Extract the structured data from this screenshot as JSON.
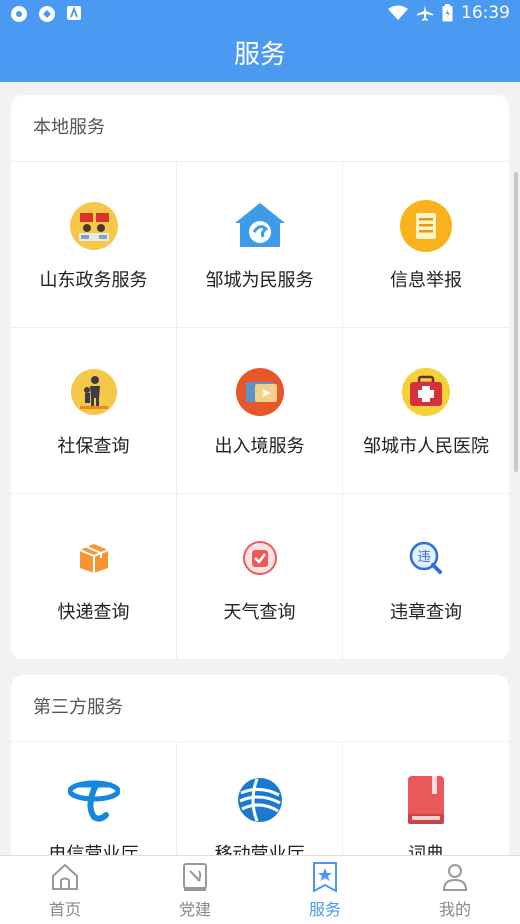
{
  "status": {
    "time": "16:39",
    "icons": [
      "app-icon-1",
      "app-icon-2",
      "app-icon-3",
      "wifi-icon",
      "airplane-icon",
      "battery-icon"
    ]
  },
  "header": {
    "title": "服务"
  },
  "local": {
    "title": "本地服务",
    "items": [
      {
        "label": "山东政务服务",
        "icon": "government-service-icon"
      },
      {
        "label": "邹城为民服务",
        "icon": "house-service-icon"
      },
      {
        "label": "信息举报",
        "icon": "report-icon"
      },
      {
        "label": "社保查询",
        "icon": "social-security-icon"
      },
      {
        "label": "出入境服务",
        "icon": "passport-icon"
      },
      {
        "label": "邹城市人民医院",
        "icon": "hospital-icon"
      },
      {
        "label": "快递查询",
        "icon": "package-icon"
      },
      {
        "label": "天气查询",
        "icon": "weather-icon"
      },
      {
        "label": "违章查询",
        "icon": "traffic-violation-icon"
      }
    ]
  },
  "third": {
    "title": "第三方服务",
    "items": [
      {
        "label": "电信营业厅",
        "icon": "china-telecom-icon"
      },
      {
        "label": "移动营业厅",
        "icon": "china-mobile-icon"
      },
      {
        "label": "词典",
        "icon": "dictionary-icon"
      }
    ]
  },
  "tabs": [
    {
      "label": "首页",
      "icon": "home-icon"
    },
    {
      "label": "党建",
      "icon": "party-building-icon"
    },
    {
      "label": "服务",
      "icon": "services-star-icon",
      "active": true
    },
    {
      "label": "我的",
      "icon": "profile-icon"
    }
  ],
  "colors": {
    "primary": "#4a9af2",
    "background": "#f2f2f4"
  }
}
